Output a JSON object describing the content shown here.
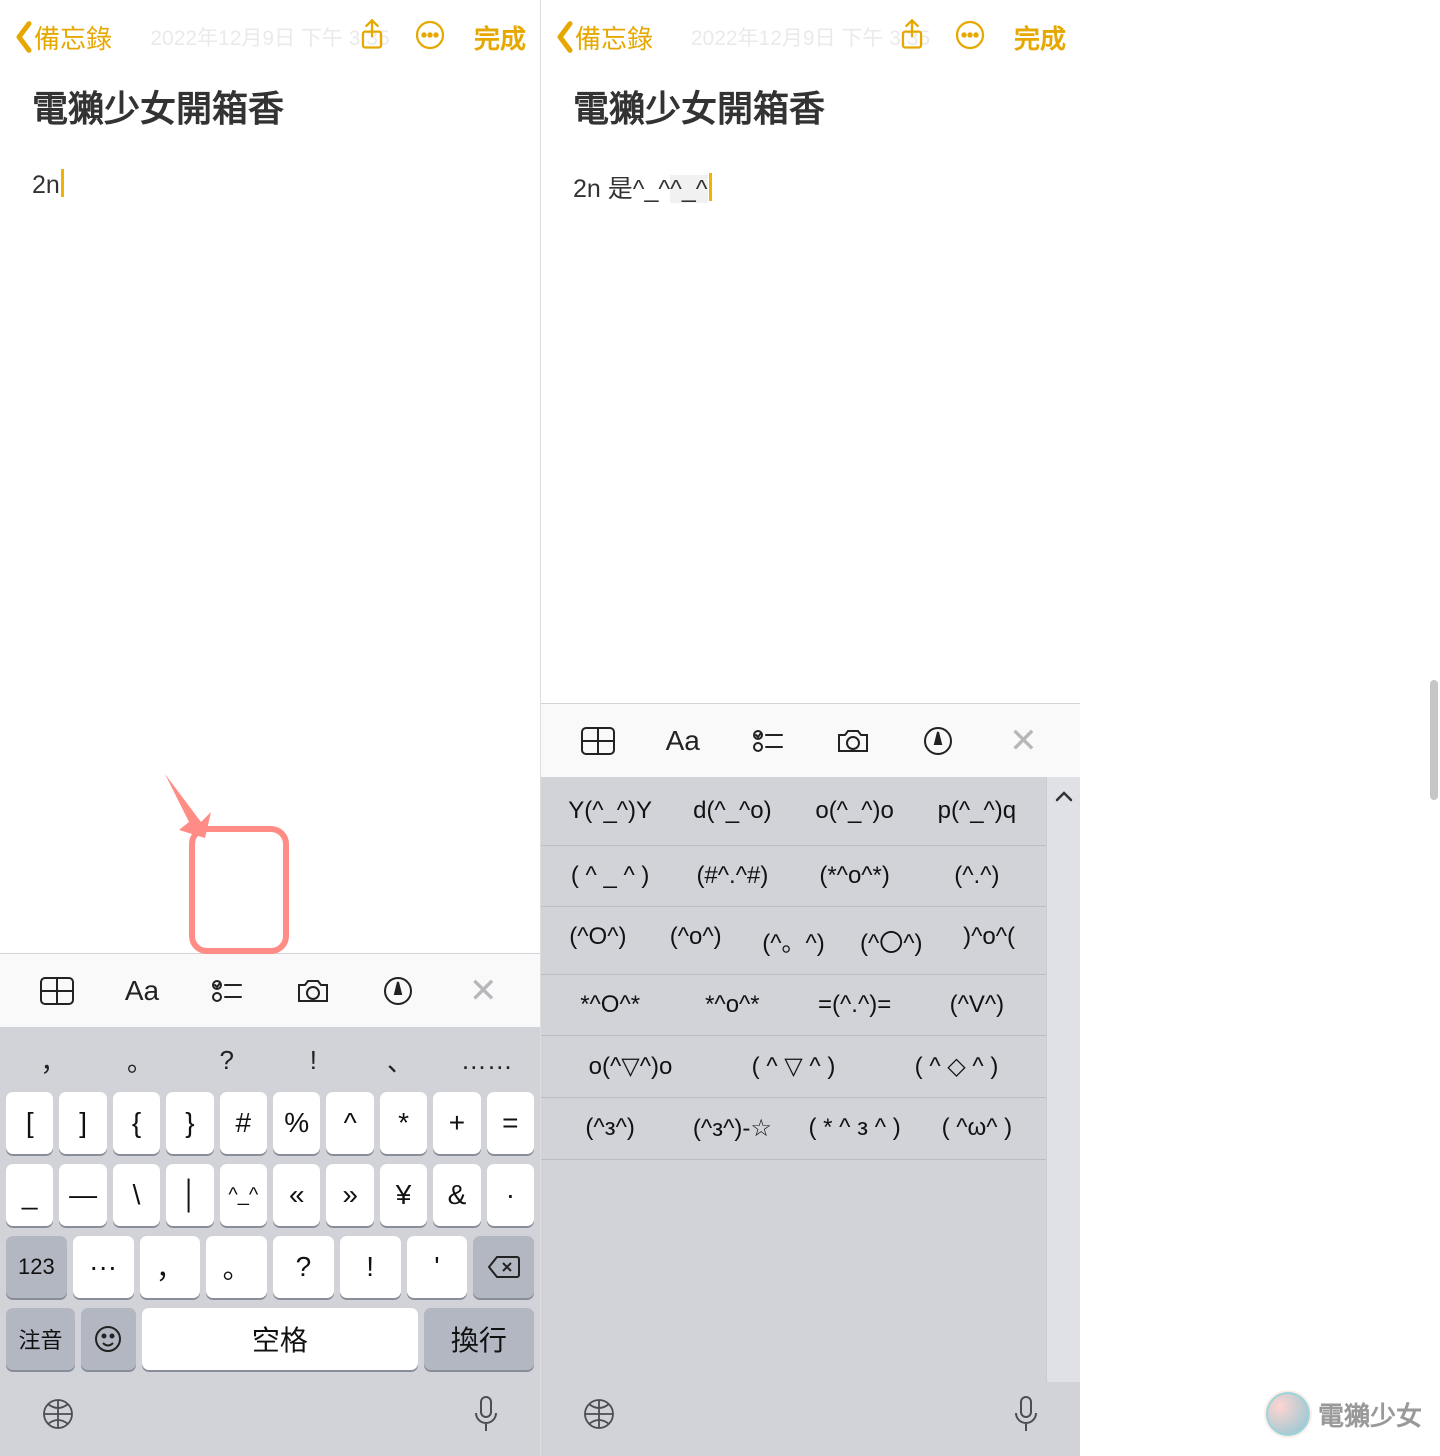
{
  "nav": {
    "back_label": "備忘錄",
    "timestamp": "2022年12月9日 下午 3:35",
    "done": "完成"
  },
  "note": {
    "title": "電獺少女開箱香",
    "left_text": "2n",
    "right_text_pre": "2n 是^_^",
    "right_text_mark": "^_^"
  },
  "toolbar": {
    "aa": "Aa"
  },
  "keyboard": {
    "sug": [
      "，",
      "。",
      "?",
      "!",
      "、",
      "……"
    ],
    "row1": [
      "[",
      "]",
      "{",
      "}",
      "#",
      "%",
      "^",
      "*",
      "+",
      "="
    ],
    "row2": [
      "_",
      "—",
      "\\",
      "│",
      "^_^",
      "«",
      "»",
      "¥",
      "&",
      "·"
    ],
    "mode123": "123",
    "row3": [
      "···",
      "，",
      "。",
      "?",
      "!",
      "'"
    ],
    "zhuyin": "注音",
    "space": "空格",
    "return": "換行"
  },
  "kaomoji": {
    "rows": [
      [
        "Y(^_^)Y",
        "d(^_^o)",
        "o(^_^)o",
        "p(^_^)q"
      ],
      [
        "( ^ _ ^ )",
        "(#^.^#)",
        "(*^o^*)",
        "(^.^)"
      ],
      [
        "(^O^)",
        "(^o^)",
        "(^。^)",
        "(^〇^)",
        ")^o^("
      ],
      [
        "*^O^*",
        "*^o^*",
        "=(^.^)=",
        "(^V^)"
      ],
      [
        "o(^▽^)o",
        "( ^ ▽ ^ )",
        "( ^ ◇ ^ )"
      ],
      [
        "(^з^)",
        "(^з^)-☆",
        "( * ^ з ^ )",
        "( ^ω^ )"
      ]
    ]
  },
  "watermark": "電獺少女"
}
